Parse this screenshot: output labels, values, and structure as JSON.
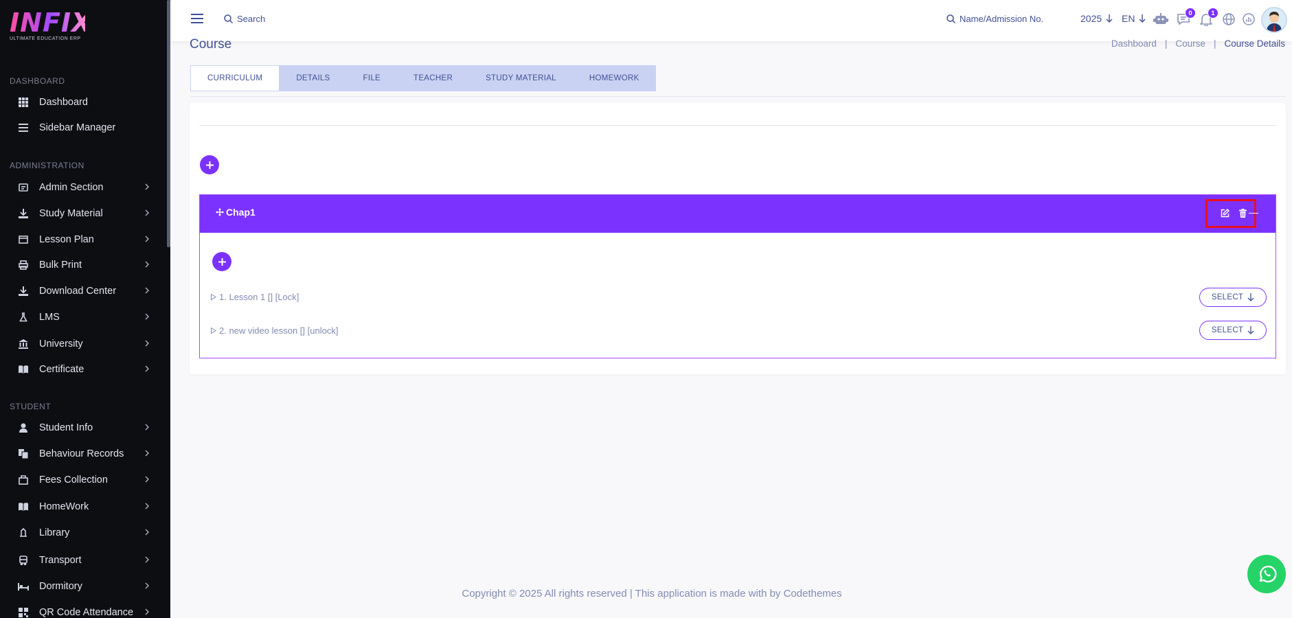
{
  "brand": {
    "logo_text": "INFIX",
    "logo_subtitle": "ULTIMATE EDUCATION ERP"
  },
  "sidebar": {
    "sections": {
      "dashboard": "DASHBOARD",
      "administration": "ADMINISTRATION",
      "student": "STUDENT"
    },
    "items": [
      {
        "label": "Dashboard",
        "icon": "grid-icon"
      },
      {
        "label": "Sidebar Manager",
        "icon": "list-icon"
      },
      {
        "label": "Admin Section",
        "icon": "admin-icon"
      },
      {
        "label": "Study Material",
        "icon": "download-icon"
      },
      {
        "label": "Lesson Plan",
        "icon": "lesson-icon"
      },
      {
        "label": "Bulk Print",
        "icon": "printer-icon"
      },
      {
        "label": "Download Center",
        "icon": "download-icon"
      },
      {
        "label": "LMS",
        "icon": "lms-icon"
      },
      {
        "label": "University",
        "icon": "bank-icon"
      },
      {
        "label": "Certificate",
        "icon": "book-icon"
      },
      {
        "label": "Student Info",
        "icon": "user-icon"
      },
      {
        "label": "Behaviour Records",
        "icon": "records-icon"
      },
      {
        "label": "Fees Collection",
        "icon": "fees-icon"
      },
      {
        "label": "HomeWork",
        "icon": "book-icon"
      },
      {
        "label": "Library",
        "icon": "library-icon"
      },
      {
        "label": "Transport",
        "icon": "bus-icon"
      },
      {
        "label": "Dormitory",
        "icon": "bed-icon"
      },
      {
        "label": "QR Code Attendance",
        "icon": "qr-icon"
      }
    ]
  },
  "header": {
    "search_label": "Search",
    "name_search_label": "Name/Admission No.",
    "year": "2025",
    "language": "EN",
    "messages_count": "0",
    "notifications_count": "1"
  },
  "page": {
    "title": "Course",
    "breadcrumb": [
      "Dashboard",
      "Course",
      "Course Details"
    ]
  },
  "tabs": [
    "CURRICULUM",
    "DETAILS",
    "FILE",
    "TEACHER",
    "STUDY MATERIAL",
    "HOMEWORK"
  ],
  "chapter": {
    "title": "Chap1",
    "collapse_symbol": "—",
    "lessons": [
      {
        "label": "1. Lesson 1 [] [Lock]",
        "button": "SELECT"
      },
      {
        "label": "2. new video lesson [] [unlock]",
        "button": "SELECT"
      }
    ]
  },
  "footer": {
    "text": "Copyright © 2025 All rights reserved | This application is made with by Codethemes"
  },
  "colors": {
    "primary": "#7c32ff",
    "text": "#415094",
    "muted": "#828bb2",
    "sidebar_bg": "#0d0e12",
    "highlight": "#e8101f",
    "whatsapp": "#25d366"
  }
}
